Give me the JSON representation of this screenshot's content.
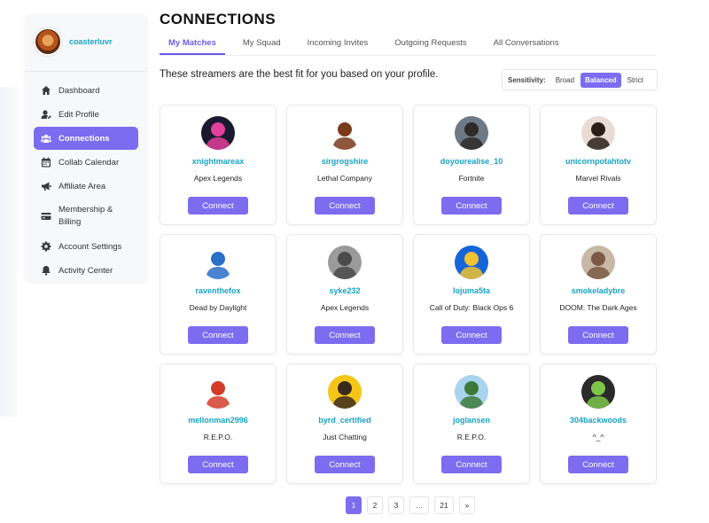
{
  "sidebar": {
    "username": "coasterluvr",
    "items": [
      {
        "label": "Dashboard",
        "icon": "home-icon",
        "active": false
      },
      {
        "label": "Edit Profile",
        "icon": "user-edit-icon",
        "active": false
      },
      {
        "label": "Connections",
        "icon": "users-icon",
        "active": true
      },
      {
        "label": "Collab Calendar",
        "icon": "calendar-icon",
        "active": false
      },
      {
        "label": "Affiliate Area",
        "icon": "megaphone-icon",
        "active": false
      },
      {
        "label": "Membership & Billing",
        "icon": "credit-card-icon",
        "active": false
      },
      {
        "label": "Account Settings",
        "icon": "gear-icon",
        "active": false
      },
      {
        "label": "Activity Center",
        "icon": "bell-icon",
        "active": false
      }
    ]
  },
  "header": {
    "title": "CONNECTIONS",
    "tabs": [
      "My Matches",
      "My Squad",
      "Incoming Invites",
      "Outgoing Requests",
      "All Conversations"
    ],
    "active_tab": 0
  },
  "main": {
    "subtitle": "These streamers are the best fit for you based on your profile.",
    "sensitivity": {
      "label": "Sensitivity:",
      "options": [
        "Broad",
        "Balanced",
        "Strict"
      ],
      "selected": "Balanced"
    },
    "connect_label": "Connect",
    "cards": [
      {
        "name": "xnightmareax",
        "game": "Apex Legends",
        "color": "#1a1a2e",
        "accent": "#e0409a"
      },
      {
        "name": "sirgrogshire",
        "game": "Lethal Company",
        "color": "#ffffff",
        "accent": "#7a3a1c"
      },
      {
        "name": "doyourealise_10",
        "game": "Fortnite",
        "color": "#6d7a85",
        "accent": "#2d2a28"
      },
      {
        "name": "unicornpotahtotv",
        "game": "Marvel Rivals",
        "color": "#e8dcd4",
        "accent": "#2a1e1a"
      },
      {
        "name": "raventhefox",
        "game": "Dead by Daylight",
        "color": "#ffffff",
        "accent": "#2a6fc9"
      },
      {
        "name": "syke232",
        "game": "Apex Legends",
        "color": "#9a9a9a",
        "accent": "#4a4a4a"
      },
      {
        "name": "lojuma5ta",
        "game": "Call of Duty: Black Ops 6",
        "color": "#1565d8",
        "accent": "#f2c230"
      },
      {
        "name": "smokeladybre",
        "game": "DOOM: The Dark Ages",
        "color": "#c9b8a6",
        "accent": "#7a5a44"
      },
      {
        "name": "mellonman2996",
        "game": "R.E.P.O.",
        "color": "#ffffff",
        "accent": "#d23c2a"
      },
      {
        "name": "byrd_certified",
        "game": "Just Chatting",
        "color": "#f5c518",
        "accent": "#3a2a1e"
      },
      {
        "name": "joglansen",
        "game": "R.E.P.O.",
        "color": "#a9d4ef",
        "accent": "#3d7a3a"
      },
      {
        "name": "304backwoods",
        "game": "^_^",
        "color": "#2a2a2a",
        "accent": "#7ec64a"
      }
    ]
  },
  "pagination": {
    "pages": [
      "1",
      "2",
      "3",
      "...",
      "21",
      "»"
    ],
    "current": "1"
  }
}
